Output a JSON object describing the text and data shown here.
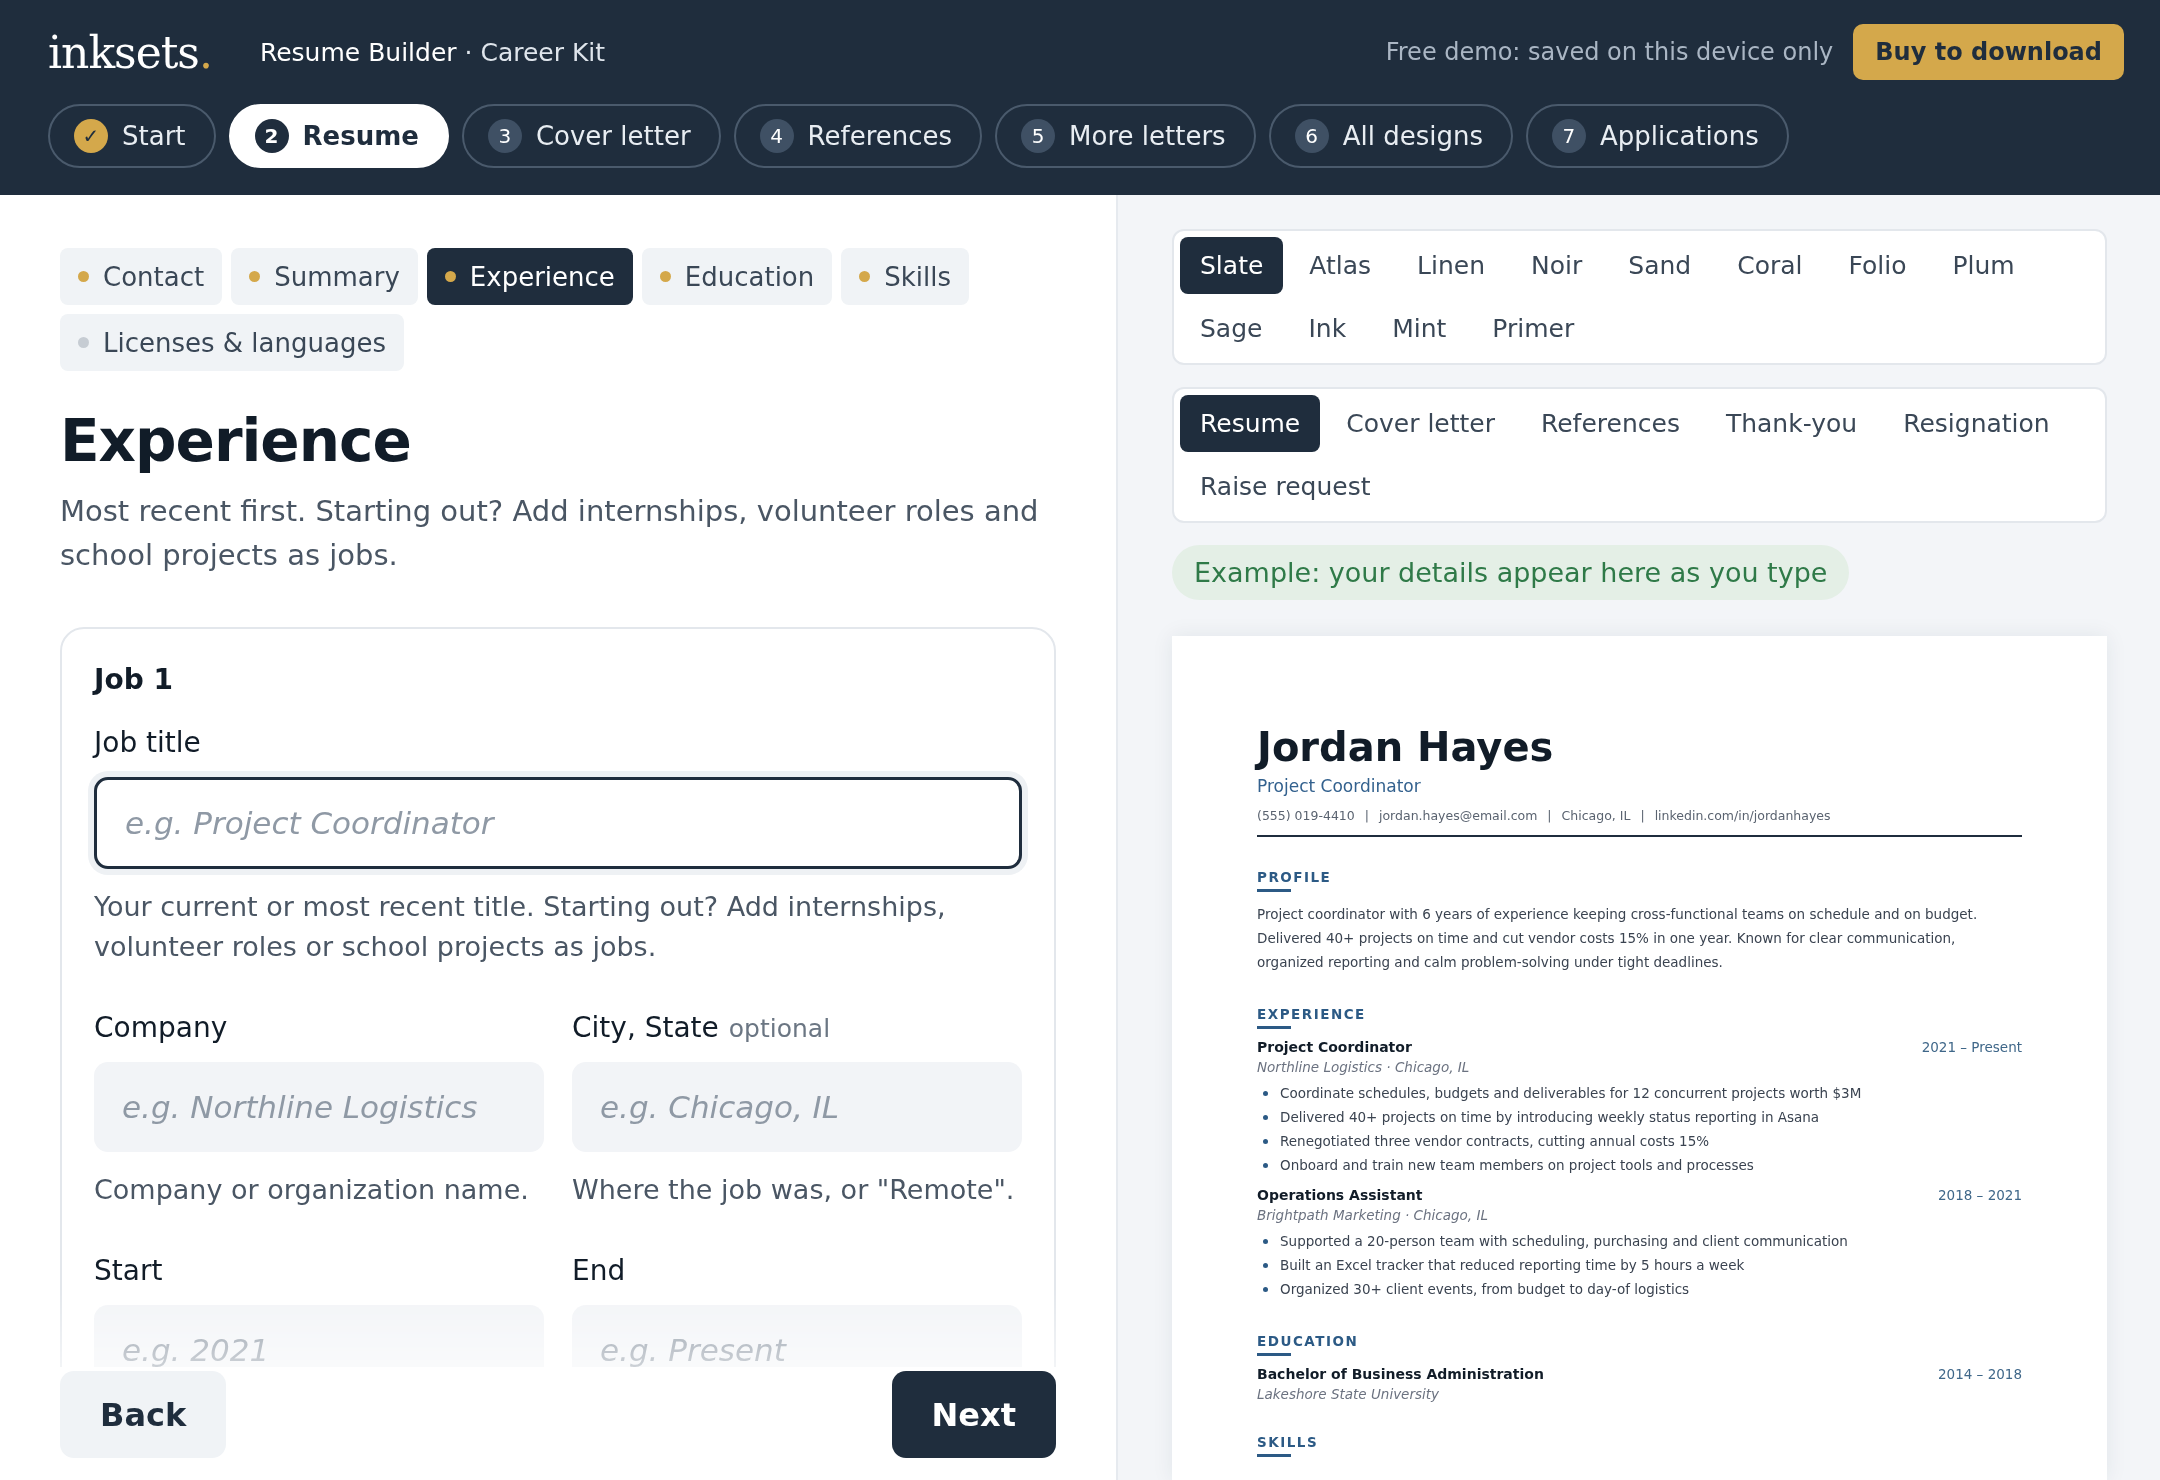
{
  "header": {
    "logo": "inksets",
    "logo_dot": ".",
    "product": "Resume Builder",
    "product_sep": "·",
    "product_sub": "Career Kit",
    "demo_note": "Free demo: saved on this device only",
    "buy_button": "Buy to download"
  },
  "steps": [
    {
      "num": "✓",
      "label": "Start",
      "done": true,
      "selected": false
    },
    {
      "num": "2",
      "label": "Resume",
      "done": false,
      "selected": true
    },
    {
      "num": "3",
      "label": "Cover letter",
      "done": false,
      "selected": false
    },
    {
      "num": "4",
      "label": "References",
      "done": false,
      "selected": false
    },
    {
      "num": "5",
      "label": "More letters",
      "done": false,
      "selected": false
    },
    {
      "num": "6",
      "label": "All designs",
      "done": false,
      "selected": false
    },
    {
      "num": "7",
      "label": "Applications",
      "done": false,
      "selected": false
    }
  ],
  "sections": [
    {
      "label": "Contact",
      "filled": true,
      "selected": false
    },
    {
      "label": "Summary",
      "filled": true,
      "selected": false
    },
    {
      "label": "Experience",
      "filled": true,
      "selected": true
    },
    {
      "label": "Education",
      "filled": true,
      "selected": false
    },
    {
      "label": "Skills",
      "filled": true,
      "selected": false
    },
    {
      "label": "Licenses & languages",
      "filled": false,
      "selected": false
    }
  ],
  "form": {
    "title": "Experience",
    "intro": "Most recent first. Starting out? Add internships, volunteer roles and school projects as jobs.",
    "job_title": "Job 1",
    "fields": [
      {
        "label": "Job title",
        "placeholder": "e.g. Project Coordinator",
        "hint": "Your current or most recent title. Starting out? Add internships, volunteer roles or school projects as jobs.",
        "focused": true,
        "wide": true
      },
      {
        "label": "Company",
        "placeholder": "e.g. Northline Logistics",
        "hint": "Company or organization name.",
        "focused": false,
        "wide": false
      },
      {
        "label": "City, State",
        "optional": "optional",
        "placeholder": "e.g. Chicago, IL",
        "hint": "Where the job was, or \"Remote\".",
        "focused": false,
        "wide": false
      },
      {
        "label": "Start",
        "placeholder": "e.g. 2021",
        "focused": false,
        "wide": false
      },
      {
        "label": "End",
        "placeholder": "e.g. Present",
        "focused": false,
        "wide": false
      }
    ],
    "back_button": "Back",
    "next_button": "Next"
  },
  "designs": [
    {
      "label": "Slate",
      "selected": true
    },
    {
      "label": "Atlas",
      "selected": false
    },
    {
      "label": "Linen",
      "selected": false
    },
    {
      "label": "Noir",
      "selected": false
    },
    {
      "label": "Sand",
      "selected": false
    },
    {
      "label": "Coral",
      "selected": false
    },
    {
      "label": "Folio",
      "selected": false
    },
    {
      "label": "Plum",
      "selected": false
    },
    {
      "label": "Sage",
      "selected": false
    },
    {
      "label": "Ink",
      "selected": false
    },
    {
      "label": "Mint",
      "selected": false
    },
    {
      "label": "Primer",
      "selected": false
    }
  ],
  "documents": [
    {
      "label": "Resume",
      "selected": true
    },
    {
      "label": "Cover letter",
      "selected": false
    },
    {
      "label": "References",
      "selected": false
    },
    {
      "label": "Thank-you",
      "selected": false
    },
    {
      "label": "Resignation",
      "selected": false
    },
    {
      "label": "Raise request",
      "selected": false
    }
  ],
  "example_note": "Example: your details appear here as you type",
  "resume": {
    "name": "Jordan Hayes",
    "role": "Project Coordinator",
    "contacts": [
      "(555) 019-4410",
      "jordan.hayes@email.com",
      "Chicago, IL",
      "linkedin.com/in/jordanhayes"
    ],
    "contact_sep": "|",
    "profile_heading": "PROFILE",
    "profile": "Project coordinator with 6 years of experience keeping cross-functional teams on schedule and on budget. Delivered 40+ projects on time and cut vendor costs 15% in one year. Known for clear communication, organized reporting and calm problem-solving under tight deadlines.",
    "experience_heading": "EXPERIENCE",
    "jobs": [
      {
        "title": "Project Coordinator",
        "dates": "2021 – Present",
        "org": "Northline Logistics · Chicago, IL",
        "bullets": [
          "Coordinate schedules, budgets and deliverables for 12 concurrent projects worth $3M",
          "Delivered 40+ projects on time by introducing weekly status reporting in Asana",
          "Renegotiated three vendor contracts, cutting annual costs 15%",
          "Onboard and train new team members on project tools and processes"
        ]
      },
      {
        "title": "Operations Assistant",
        "dates": "2018 – 2021",
        "org": "Brightpath Marketing · Chicago, IL",
        "bullets": [
          "Supported a 20-person team with scheduling, purchasing and client communication",
          "Built an Excel tracker that reduced reporting time by 5 hours a week",
          "Organized 30+ client events, from budget to day-of logistics"
        ]
      }
    ],
    "education_heading": "EDUCATION",
    "degree": "Bachelor of Business Administration",
    "degree_dates": "2014 – 2018",
    "school": "Lakeshore State University",
    "skills_heading": "SKILLS"
  }
}
